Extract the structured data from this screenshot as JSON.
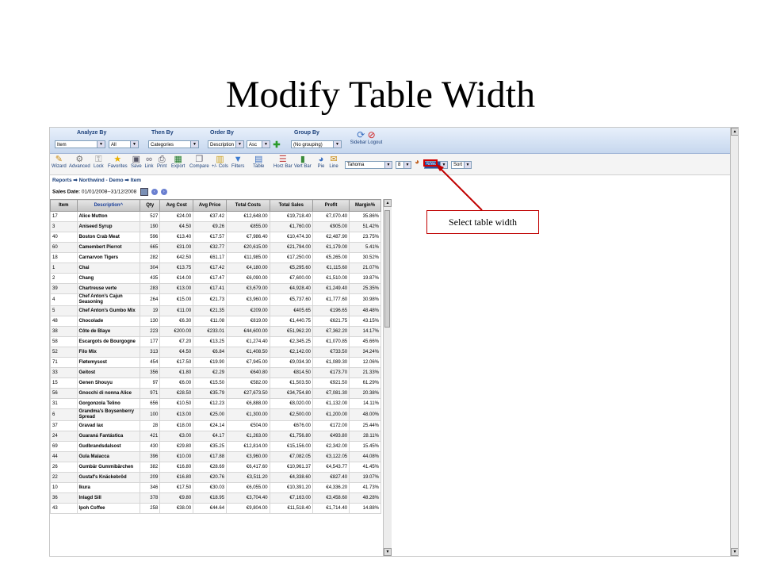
{
  "slide": {
    "title": "Modify Table Width"
  },
  "selectors": {
    "analyze_by": {
      "label": "Analyze By",
      "value1": "Item",
      "value2": "All"
    },
    "then_by": {
      "label": "Then By",
      "value": "Categories"
    },
    "order_by": {
      "label": "Order By",
      "value1": "Description",
      "value2": "Asc"
    },
    "group_by": {
      "label": "Group By",
      "value": "(No grouping)"
    },
    "sidebar_logout": "Sidebar Logout",
    "add_icon": "plus-icon"
  },
  "toolbar": {
    "buttons": [
      "Wizard",
      "Advanced",
      "Lock",
      "Favorites",
      "Save",
      "Link",
      "Print",
      "Export",
      "Compare",
      "+/- Cols",
      "Filters",
      "Table",
      "Horz Bar",
      "Vert Bar",
      "Pie",
      "Line"
    ],
    "font": "Tahoma",
    "font_size": "8",
    "table_width": "50%",
    "sort": "Sort"
  },
  "breadcrumb": "Reports ➡ Northwind - Demo ➡ Item",
  "sales_date": {
    "label": "Sales Date:",
    "value": "01/01/2008--31/12/2008"
  },
  "table": {
    "headers": [
      "Item",
      "Description^",
      "Qty",
      "Avg Cost",
      "Avg Price",
      "Total Costs",
      "Total Sales",
      "Profit",
      "Margin%"
    ],
    "rows": [
      [
        "17",
        "Alice Mutton",
        "527",
        "€24.00",
        "€37.42",
        "€12,648.00",
        "€19,718.40",
        "€7,070.40",
        "35.86%"
      ],
      [
        "3",
        "Aniseed Syrup",
        "190",
        "€4.50",
        "€9.26",
        "€855.00",
        "€1,760.00",
        "€905.00",
        "51.42%"
      ],
      [
        "40",
        "Boston Crab Meat",
        "596",
        "€13.40",
        "€17.57",
        "€7,986.40",
        "€10,474.30",
        "€2,487.90",
        "23.75%"
      ],
      [
        "60",
        "Camembert Pierrot",
        "665",
        "€31.00",
        "€32.77",
        "€20,615.00",
        "€21,794.00",
        "€1,179.00",
        "5.41%"
      ],
      [
        "18",
        "Carnarvon Tigers",
        "282",
        "€42.50",
        "€61.17",
        "€11,985.00",
        "€17,250.00",
        "€5,265.00",
        "30.52%"
      ],
      [
        "1",
        "Chai",
        "304",
        "€13.75",
        "€17.42",
        "€4,180.00",
        "€5,295.60",
        "€1,115.60",
        "21.07%"
      ],
      [
        "2",
        "Chang",
        "435",
        "€14.00",
        "€17.47",
        "€6,090.00",
        "€7,600.00",
        "€1,510.00",
        "19.87%"
      ],
      [
        "39",
        "Chartreuse verte",
        "283",
        "€13.00",
        "€17.41",
        "€3,679.00",
        "€4,928.40",
        "€1,249.40",
        "25.35%"
      ],
      [
        "4",
        "Chef Anton's Cajun Seasoning",
        "264",
        "€15.00",
        "€21.73",
        "€3,960.00",
        "€5,737.60",
        "€1,777.60",
        "30.98%"
      ],
      [
        "5",
        "Chef Anton's Gumbo Mix",
        "19",
        "€11.00",
        "€21.35",
        "€209.00",
        "€405.65",
        "€196.65",
        "48.48%"
      ],
      [
        "48",
        "Chocolade",
        "130",
        "€6.30",
        "€11.08",
        "€819.00",
        "€1,440.75",
        "€621.75",
        "43.15%"
      ],
      [
        "38",
        "Côte de Blaye",
        "223",
        "€200.00",
        "€233.01",
        "€44,600.00",
        "€51,962.20",
        "€7,362.20",
        "14.17%"
      ],
      [
        "58",
        "Escargots de Bourgogne",
        "177",
        "€7.20",
        "€13.25",
        "€1,274.40",
        "€2,345.25",
        "€1,070.85",
        "45.66%"
      ],
      [
        "52",
        "Filo Mix",
        "313",
        "€4.50",
        "€6.84",
        "€1,408.50",
        "€2,142.00",
        "€733.50",
        "34.24%"
      ],
      [
        "71",
        "Fløtemysost",
        "454",
        "€17.50",
        "€19.90",
        "€7,945.00",
        "€9,034.30",
        "€1,089.30",
        "12.06%"
      ],
      [
        "33",
        "Geitost",
        "356",
        "€1.80",
        "€2.29",
        "€640.80",
        "€814.50",
        "€173.70",
        "21.33%"
      ],
      [
        "15",
        "Genen Shouyu",
        "97",
        "€6.00",
        "€15.50",
        "€582.00",
        "€1,503.50",
        "€921.50",
        "61.29%"
      ],
      [
        "56",
        "Gnocchi di nonna Alice",
        "971",
        "€28.50",
        "€35.79",
        "€27,673.50",
        "€34,754.80",
        "€7,081.30",
        "20.38%"
      ],
      [
        "31",
        "Gorgonzola Telino",
        "656",
        "€10.50",
        "€12.23",
        "€6,888.00",
        "€8,020.00",
        "€1,132.00",
        "14.11%"
      ],
      [
        "6",
        "Grandma's Boysenberry Spread",
        "100",
        "€13.00",
        "€25.00",
        "€1,300.00",
        "€2,500.00",
        "€1,200.00",
        "48.00%"
      ],
      [
        "37",
        "Gravad lax",
        "28",
        "€18.00",
        "€24.14",
        "€504.00",
        "€676.00",
        "€172.00",
        "25.44%"
      ],
      [
        "24",
        "Guaraná Fantástica",
        "421",
        "€3.00",
        "€4.17",
        "€1,263.00",
        "€1,756.80",
        "€493.80",
        "28.11%"
      ],
      [
        "69",
        "Gudbrandsdalsost",
        "430",
        "€29.80",
        "€35.25",
        "€12,814.00",
        "€15,156.00",
        "€2,342.00",
        "15.45%"
      ],
      [
        "44",
        "Gula Malacca",
        "396",
        "€10.00",
        "€17.88",
        "€3,960.00",
        "€7,082.05",
        "€3,122.05",
        "44.08%"
      ],
      [
        "26",
        "Gumbär Gummibärchen",
        "382",
        "€16.80",
        "€28.69",
        "€6,417.60",
        "€10,961.37",
        "€4,543.77",
        "41.45%"
      ],
      [
        "22",
        "Gustaf's Knäckebröd",
        "209",
        "€16.80",
        "€20.76",
        "€3,511.20",
        "€4,338.60",
        "€827.40",
        "19.07%"
      ],
      [
        "10",
        "Ikura",
        "346",
        "€17.50",
        "€30.03",
        "€6,055.00",
        "€10,391.20",
        "€4,336.20",
        "41.73%"
      ],
      [
        "36",
        "Inlagd Sill",
        "378",
        "€9.80",
        "€18.95",
        "€3,704.40",
        "€7,163.00",
        "€3,458.60",
        "48.28%"
      ],
      [
        "43",
        "Ipoh Coffee",
        "258",
        "€38.00",
        "€44.64",
        "€9,804.00",
        "€11,518.40",
        "€1,714.40",
        "14.88%"
      ]
    ]
  },
  "callout": {
    "text": "Select table width",
    "color": "#c00000"
  },
  "colors": {
    "header_bar": "#c6d7ee",
    "accent": "#1a3f7a"
  }
}
